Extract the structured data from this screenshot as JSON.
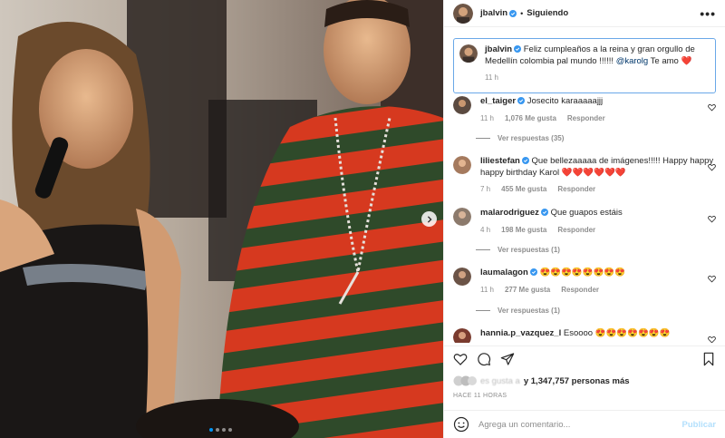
{
  "post": {
    "author": "jbalvin",
    "follow_label": "Siguiendo",
    "separator": "•",
    "more_label": "•••",
    "caption": {
      "username": "jbalvin",
      "text_before": "Feliz cumpleaños a la reina y gran orgullo de Medellín colombia pal mundo !!!!!! ",
      "mention": "@karolg",
      "text_after": " Te amo ❤️",
      "time": "11 h"
    },
    "media": {
      "slides": 4,
      "active_slide": 0
    }
  },
  "comments": [
    {
      "username": "el_taiger",
      "verified": true,
      "text": "Josecito karaaaaajjj",
      "time": "11 h",
      "likes": "1,076 Me gusta",
      "reply": "Responder",
      "view_replies": "Ver respuestas (35)"
    },
    {
      "username": "liliestefan",
      "verified": true,
      "text": "Que bellezaaaaa de imágenes!!!!! Happy happy happy birthday Karol ❤️❤️❤️❤️❤️❤️",
      "time": "7 h",
      "likes": "455 Me gusta",
      "reply": "Responder",
      "view_replies": ""
    },
    {
      "username": "malarodriguez",
      "verified": true,
      "text": "Que guapos estáis",
      "time": "4 h",
      "likes": "198 Me gusta",
      "reply": "Responder",
      "view_replies": "Ver respuestas (1)"
    },
    {
      "username": "laumalagon",
      "verified": true,
      "text": "😍😍😍😍😍😍😍😍",
      "time": "11 h",
      "likes": "277 Me gusta",
      "reply": "Responder",
      "view_replies": "Ver respuestas (1)"
    },
    {
      "username": "hannia.p_vazquez_l",
      "verified": false,
      "text": "Esoooo 😍😍😍😍😍😍😍",
      "time": "",
      "likes": "",
      "reply": "",
      "view_replies": ""
    }
  ],
  "likes_summary": {
    "blurred_prefix": "es gusta a",
    "suffix": "y 1,347,757 personas más"
  },
  "time_ago": "HACE 11 HORAS",
  "comment_box": {
    "placeholder": "Agrega un comentario...",
    "publish_label": "Publicar"
  },
  "colors": {
    "accent": "#0095f6",
    "verified": "#3897f0",
    "publish_disabled": "#b2dffc",
    "heart": "#ed4956"
  }
}
